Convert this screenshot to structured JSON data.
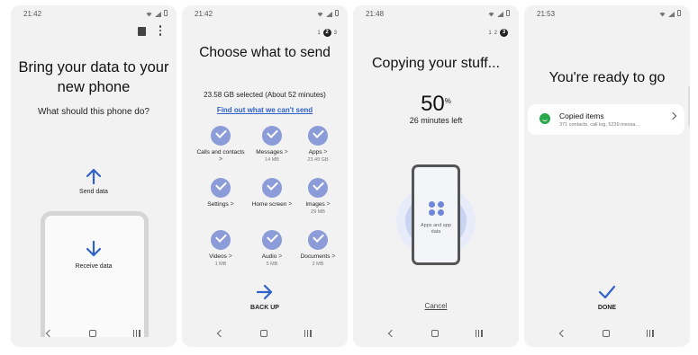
{
  "screens": [
    {
      "time": "21:42",
      "title": "Bring your data to your new phone",
      "subtitle": "What should this phone do?",
      "send_label": "Send data",
      "receive_label": "Receive data"
    },
    {
      "time": "21:42",
      "pager": [
        "1",
        "2",
        "3"
      ],
      "title": "Choose what to send",
      "summary": "23.58 GB  selected (About 52 minutes)",
      "link": "Find out what we can't send",
      "items": [
        {
          "label": "Calls and contacts",
          "size": ""
        },
        {
          "label": "Messages",
          "size": "14 MB"
        },
        {
          "label": "Apps",
          "size": "23.49 GB"
        },
        {
          "label": "Settings",
          "size": ""
        },
        {
          "label": "Home screen",
          "size": ""
        },
        {
          "label": "Images",
          "size": "29 MB"
        },
        {
          "label": "Videos",
          "size": "1 MB"
        },
        {
          "label": "Audio",
          "size": "5 MB"
        },
        {
          "label": "Documents",
          "size": "2 MB"
        }
      ],
      "backup_label": "BACK UP"
    },
    {
      "time": "21:48",
      "pager": [
        "1",
        "2",
        "3"
      ],
      "title": "Copying your stuff...",
      "percent": "50",
      "percent_unit": "%",
      "time_left": "26 minutes left",
      "device_label": "Apps and app data",
      "cancel_label": "Cancel"
    },
    {
      "time": "21:53",
      "title": "You're ready to go",
      "card_title": "Copied items",
      "card_subtitle": "371 contacts, call log, 5239 messa...",
      "done_label": "DONE"
    }
  ],
  "colors": {
    "accent": "#3062c9",
    "check_bg": "#8b9cd8",
    "success": "#27a84a"
  }
}
